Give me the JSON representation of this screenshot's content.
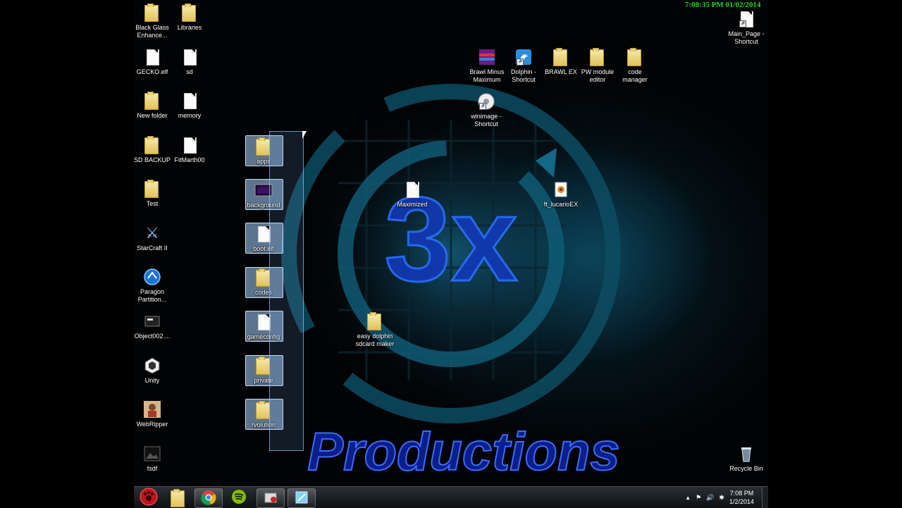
{
  "overlay": {
    "clock_text": "7:08:35 PM 01/02/2014"
  },
  "wallpaper": {
    "big_text": "3x",
    "productions_text": "Productions"
  },
  "icons_left": [
    {
      "label": "Black Glass\nEnhance...",
      "icon": "folder-icon"
    },
    {
      "label": "Libraries",
      "icon": "libraries-icon"
    },
    {
      "label": "GECKO.elf",
      "icon": "file-icon"
    },
    {
      "label": "sd",
      "icon": "file-icon"
    },
    {
      "label": "New folder",
      "icon": "folder-icon"
    },
    {
      "label": "memory",
      "icon": "file-icon"
    },
    {
      "label": "SD BACKUP",
      "icon": "folder-icon"
    },
    {
      "label": "FitMarth00",
      "icon": "file-icon"
    },
    {
      "label": "Test",
      "icon": "folder-icon"
    },
    {
      "label": "StarCraft II",
      "icon": "starcraft-icon"
    },
    {
      "label": "Paragon\nPartition...",
      "icon": "paragon-icon"
    },
    {
      "label": "Object002....",
      "icon": "object-icon"
    },
    {
      "label": "Unity",
      "icon": "unity-icon"
    },
    {
      "label": "WebRipper",
      "icon": "webripper-icon"
    },
    {
      "label": "fsdf",
      "icon": "image-icon"
    }
  ],
  "selected_icons": [
    {
      "label": "apps",
      "icon": "folder-icon"
    },
    {
      "label": "background",
      "icon": "image-icon"
    },
    {
      "label": "boot.elf",
      "icon": "file-icon"
    },
    {
      "label": "codes",
      "icon": "folder-icon"
    },
    {
      "label": "gameconfig",
      "icon": "file-icon"
    },
    {
      "label": "private",
      "icon": "folder-icon"
    },
    {
      "label": "rvolution",
      "icon": "folder-icon"
    }
  ],
  "icons_top": [
    {
      "label": "Brawl Minus\nMaximum",
      "icon": "brawl-icon"
    },
    {
      "label": "Dolphin -\nShortcut",
      "icon": "dolphin-icon"
    },
    {
      "label": "BRAWL EX",
      "icon": "folder-icon"
    },
    {
      "label": "PW module\neditor",
      "icon": "folder-icon"
    },
    {
      "label": "code\nmanager",
      "icon": "folder-icon"
    },
    {
      "label": "winimage -\nShortcut",
      "icon": "winimage-icon"
    },
    {
      "label": "Main_Page -\nShortcut",
      "icon": "file-icon"
    }
  ],
  "icons_middle": [
    {
      "label": "Maximized",
      "icon": "file-icon"
    },
    {
      "label": "ft_lucarioEX",
      "icon": "lucario-icon"
    },
    {
      "label": "easy dolphin\nsdcard maker",
      "icon": "folder-icon"
    },
    {
      "label": "Recycle Bin",
      "icon": "recycle-bin-icon"
    }
  ],
  "taskbar": {
    "buttons": [
      {
        "name": "start-orb",
        "icon": "start-orb-icon"
      },
      {
        "name": "explorer",
        "icon": "folder-icon"
      },
      {
        "name": "chrome",
        "icon": "chrome-icon"
      },
      {
        "name": "spotify",
        "icon": "spotify-icon"
      },
      {
        "name": "app",
        "icon": "app-icon"
      },
      {
        "name": "dolphin",
        "icon": "dolphin-icon"
      }
    ],
    "time": "7:08 PM",
    "date": "1/2/2014"
  },
  "colors": {
    "overlay_clock": "#22d62a",
    "wallpaper_blue": "#1e4fe8",
    "wallpaper_cyan": "#1a90b8"
  }
}
